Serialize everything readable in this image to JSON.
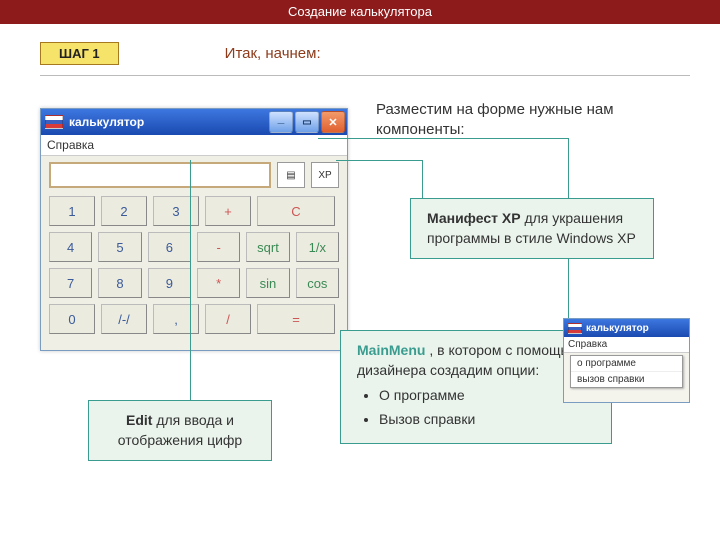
{
  "top_title": "Создание калькулятора",
  "step_label": "ШАГ 1",
  "begin_text": "Итак, начнем:",
  "lead_text": " Разместим на форме нужные нам компоненты:",
  "calc": {
    "title": "калькулятор",
    "menu_ref": "Справка",
    "grid": [
      [
        "1",
        "2",
        "3",
        "+",
        "C"
      ],
      [
        "4",
        "5",
        "6",
        "-",
        "sqrt",
        "1/x"
      ],
      [
        "7",
        "8",
        "9",
        "*",
        "sin",
        "cos"
      ],
      [
        "0",
        "/-/",
        ",",
        "/",
        "="
      ]
    ],
    "design_icon1": "▤",
    "design_icon2": "XP"
  },
  "thumb": {
    "title": "калькулятор",
    "menu_ref": "Справка",
    "dropdown": [
      "о программе",
      "вызов справки"
    ]
  },
  "edit_callout": {
    "bold": "Edit",
    "rest": " для ввода и отображения цифр"
  },
  "xp_callout": {
    "bold": "Манифест ХР",
    "rest": " для украшения программы в стиле Windows XP"
  },
  "menu_callout": {
    "bold": "MainMenu",
    "rest": " , в котором с помощью дизайнера создадим опции:",
    "items": [
      "О программе",
      "Вызов справки"
    ]
  }
}
